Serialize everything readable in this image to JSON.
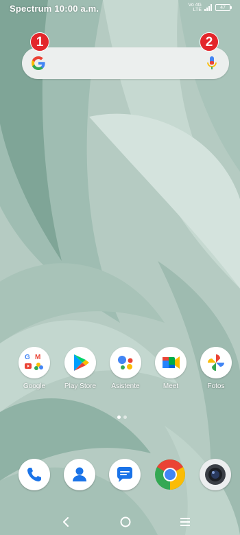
{
  "status_bar": {
    "carrier": "Spectrum",
    "time": "10:00 a.m.",
    "network_top": "Vo 4G",
    "network_bottom": "LTE",
    "battery": "47"
  },
  "search": {
    "badge_left": "1",
    "badge_right": "2"
  },
  "home_apps": [
    {
      "label": "Google"
    },
    {
      "label": "Play Store"
    },
    {
      "label": "Asistente"
    },
    {
      "label": "Meet"
    },
    {
      "label": "Fotos"
    }
  ],
  "dock": [
    "phone-icon",
    "contacts-icon",
    "messages-icon",
    "chrome-icon",
    "camera-icon"
  ],
  "colors": {
    "badge_red": "#e3262b",
    "wallpaper": "#b7cdc4",
    "search_bar": "#ecefee"
  }
}
